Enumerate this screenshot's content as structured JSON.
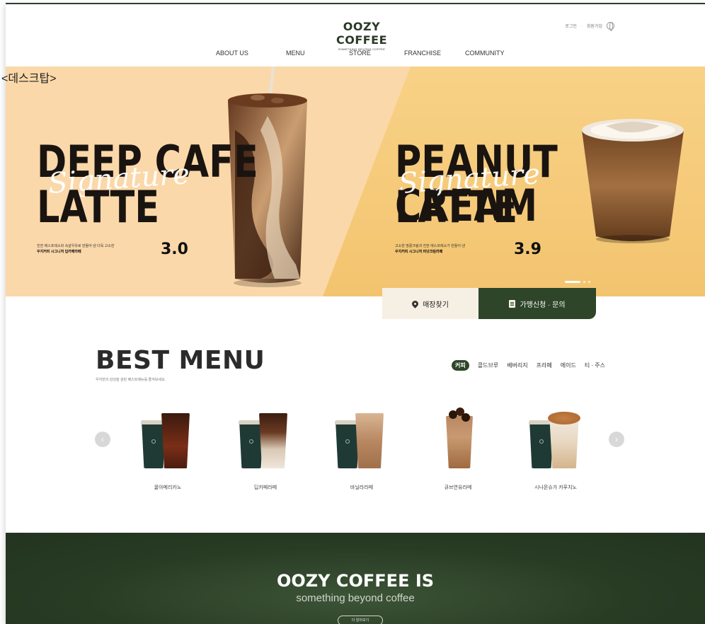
{
  "desktop_label": "<데스크탑>",
  "header": {
    "logo": "OOZY COFFEE",
    "logo_tagline": "SOMETHING BEYOND COFFEE",
    "util": {
      "login": "로그인",
      "join": "회원가입"
    },
    "nav": [
      "ABOUT US",
      "MENU",
      "STORE",
      "FRANCHISE",
      "COMMUNITY"
    ]
  },
  "hero": {
    "slides": [
      {
        "title_line1": "DEEP CAFE",
        "title_line2": "LATTE",
        "script": "Signature",
        "desc_line1": "진한 에스프레소와 속살우유로 만들어 낸 더욱 고소한",
        "desc_line2": "우지커피 시그니처 딥카페라떼",
        "price": "3.0"
      },
      {
        "title_line1": "PEANUT CREAM",
        "title_line2": "LATTE",
        "script": "Signature",
        "desc_line1": "고소한 땅콩크림과 진한 에스프레소가 만들어 낸",
        "desc_line2": "우지커피 시그니처 피넛크림라떼",
        "price": "3.9"
      }
    ],
    "colors": {
      "left_bg": "#fbd8a9",
      "right_bg": "#f3c46f"
    }
  },
  "actions": {
    "store": "매장찾기",
    "franchise": "가맹신청 · 문의"
  },
  "best_menu": {
    "title": "BEST MENU",
    "subtitle": "우지만의 감성을 살린 베스트메뉴를 즐겨보세요.",
    "tabs": [
      "커피",
      "콜드브루",
      "베버리지",
      "프라페",
      "에이드",
      "티 · 주스"
    ],
    "active_tab": "커피",
    "products": [
      "꿀아메리카노",
      "딥카페라떼",
      "바닐라라떼",
      "큐브연유라떼",
      "시나몬슈가 카푸치노"
    ]
  },
  "banner": {
    "title": "OOZY COFFEE IS",
    "subtitle": "something beyond coffee",
    "button": "더 알아보기"
  },
  "colors": {
    "brand_green": "#2e4529",
    "banner_green": "#283c24"
  }
}
